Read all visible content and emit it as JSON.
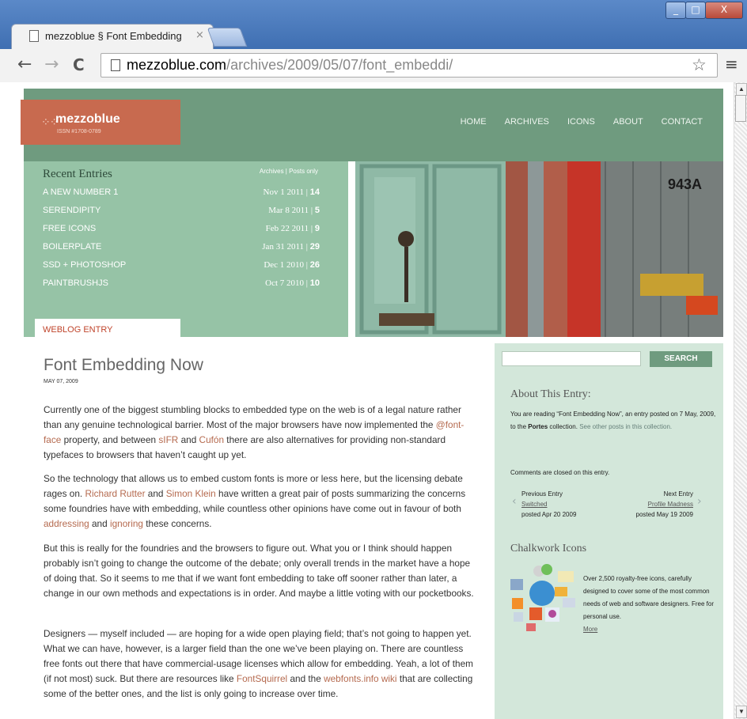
{
  "browser": {
    "tab_title": "mezzoblue § Font Embedding",
    "tab_close": "×",
    "url_host": "mezzoblue.com",
    "url_path": "/archives/2009/05/07/font_embeddi/",
    "window_buttons": {
      "minimize": "_",
      "maximize": "□",
      "close": "X"
    },
    "nav": {
      "back": "←",
      "forward": "→",
      "reload": "C"
    },
    "star": "☆",
    "menu": "≡"
  },
  "site": {
    "logo_name": "mezzoblue",
    "logo_issn": "ISSN #1708-0789",
    "nav": [
      "HOME",
      "ARCHIVES",
      "ICONS",
      "ABOUT",
      "CONTACT"
    ]
  },
  "recent": {
    "title": "Recent Entries",
    "links": "Archives | Posts only",
    "entries": [
      {
        "title": "A NEW NUMBER 1",
        "date": "Nov 1 2011 |",
        "count": "14"
      },
      {
        "title": "SERENDIPITY",
        "date": "Mar 8 2011 |",
        "count": "5"
      },
      {
        "title": "FREE ICONS",
        "date": "Feb 22 2011 |",
        "count": "9"
      },
      {
        "title": "BOILERPLATE",
        "date": "Jan 31 2011 |",
        "count": "29"
      },
      {
        "title": "SSD + PHOTOSHOP",
        "date": "Dec 1 2010 |",
        "count": "26"
      },
      {
        "title": "PAINTBRUSHJS",
        "date": "Oct 7 2010 |",
        "count": "10"
      }
    ]
  },
  "photo": {
    "house_number": "943A"
  },
  "weblog_tab": "WEBLOG ENTRY",
  "article": {
    "title": "Font Embedding Now",
    "date": "MAY 07, 2009",
    "p1": {
      "a": "Currently one of the biggest stumbling blocks to embedded type on the web is of a legal nature rather than any genuine technological barrier. Most of the major browsers have now implemented the ",
      "l1": "@font-face",
      "b": " property, and between ",
      "l2": "sIFR",
      "c": " and ",
      "l3": "Cufón",
      "d": " there are also alternatives for providing non-standard typefaces to browsers that haven’t caught up yet."
    },
    "p2": {
      "a": "So the technology that allows us to embed custom fonts is more or less here, but the licensing debate rages on. ",
      "l1": "Richard Rutter",
      "b": " and ",
      "l2": "Simon Klein",
      "c": " have written a great pair of posts summarizing the concerns some foundries have with embedding, while countless other opinions have come out in favour of both ",
      "l3": "addressing",
      "d": " and ",
      "l4": "ignoring",
      "e": " these concerns."
    },
    "p3": "But this is really for the foundries and the browsers to figure out. What you or I think should happen probably isn’t going to change the outcome of the debate; only overall trends in the market have a hope of doing that. So it seems to me that if we want font embedding to take off sooner rather than later, a change in our own methods and expectations is in order. And maybe a little voting with our pocketbooks.",
    "p4": {
      "a": "Designers — myself included — are hoping for a wide open playing field; that’s not going to happen yet. What we can have, however, is a larger field than the one we’ve been playing on. There are countless free fonts out there that have commercial-usage licenses which allow for embedding. Yeah, a lot of them (if not most) suck. But there are resources like ",
      "l1": "FontSquirrel",
      "b": " and the ",
      "l2": "webfonts.info wiki",
      "c": " that are collecting some of the better ones, and the list is only going to increase over time."
    }
  },
  "sidebar": {
    "search_button": "SEARCH",
    "about_title": "About This Entry:",
    "about_a": "You are reading “Font Embedding Now”, an entry posted on 7 May, 2009, to the ",
    "about_collection": "Portes",
    "about_b": " collection. ",
    "about_link": "See other posts in this collection.",
    "comments": "Comments are closed on this entry.",
    "prev_label": "Previous Entry",
    "prev_title": "Switched",
    "prev_date": "posted Apr 20 2009",
    "next_label": "Next Entry",
    "next_title": "Profile Madness",
    "next_date": "posted May 19 2009",
    "chalk_title": "Chalkwork Icons",
    "chalk_text": "Over 2,500 royalty-free icons, carefully designed to cover some of the most common needs of web and software designers. Free for personal use.",
    "chalk_more": "More"
  }
}
